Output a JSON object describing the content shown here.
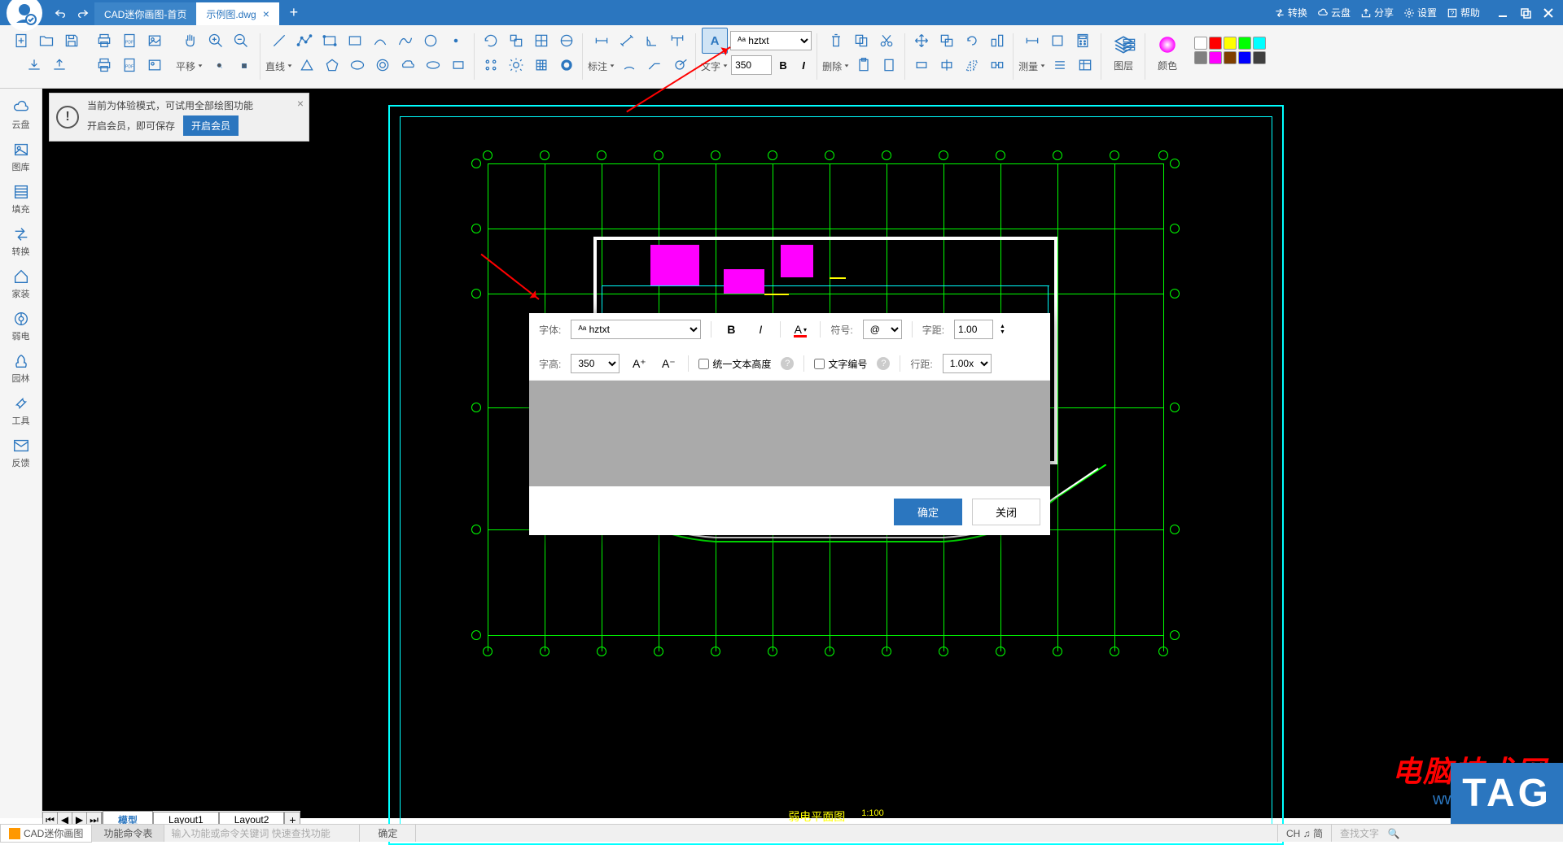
{
  "titlebar": {
    "tabs": [
      {
        "label": "CAD迷你画图-首页",
        "active": false
      },
      {
        "label": "示例图.dwg",
        "active": true
      }
    ],
    "links": {
      "convert": "转换",
      "cloud": "云盘",
      "share": "分享",
      "settings": "设置",
      "help": "帮助"
    }
  },
  "toolbar": {
    "pan_label": "平移",
    "line_label": "直线",
    "annotate_label": "标注",
    "text_label": "文字",
    "font_name": "hztxt",
    "font_size": "350",
    "bold": "B",
    "italic": "I",
    "delete_label": "删除",
    "measure_label": "测量",
    "layer_label": "图层",
    "color_label": "颜色",
    "colors": [
      "#ffffff",
      "#ff0000",
      "#ffff00",
      "#00ff00",
      "#00ffff",
      "#808080",
      "#ff00ff",
      "#7f3f00",
      "#0000ff",
      "#3f3f3f"
    ]
  },
  "sidebar": {
    "items": [
      {
        "label": "云盘"
      },
      {
        "label": "图库"
      },
      {
        "label": "填充"
      },
      {
        "label": "转换"
      },
      {
        "label": "家装"
      },
      {
        "label": "弱电"
      },
      {
        "label": "园林"
      },
      {
        "label": "工具"
      },
      {
        "label": "反馈"
      }
    ]
  },
  "notification": {
    "line1": "当前为体验模式，可试用全部绘图功能",
    "line2": "开启会员，即可保存",
    "button": "开启会员"
  },
  "text_dialog": {
    "font_label": "字体:",
    "font_value": "hztxt",
    "symbol_label": "符号:",
    "symbol_value": "@",
    "spacing_label": "字距:",
    "spacing_value": "1.00",
    "height_label": "字高:",
    "height_value": "350",
    "a_plus": "A⁺",
    "a_minus": "A⁻",
    "uniform_height": "统一文本高度",
    "text_number": "文字编号",
    "line_spacing_label": "行距:",
    "line_spacing_value": "1.00x",
    "bold": "B",
    "italic": "I",
    "underline": "A",
    "ok": "确定",
    "close": "关闭"
  },
  "drawing": {
    "title": "弱电平面图",
    "scale": "1:100"
  },
  "bottom_tabs": {
    "items": [
      "模型",
      "Layout1",
      "Layout2"
    ]
  },
  "statusbar": {
    "app": "CAD迷你画图",
    "cmd_tab": "功能命令表",
    "cmd_placeholder": "输入功能或命令关键词 快速查找功能",
    "ok": "确定",
    "ime": "CH ♫ 简",
    "search": "查找文字"
  },
  "watermark": {
    "title": "电脑技术网",
    "url": "www.tagxp.com",
    "tag": "TAG"
  }
}
